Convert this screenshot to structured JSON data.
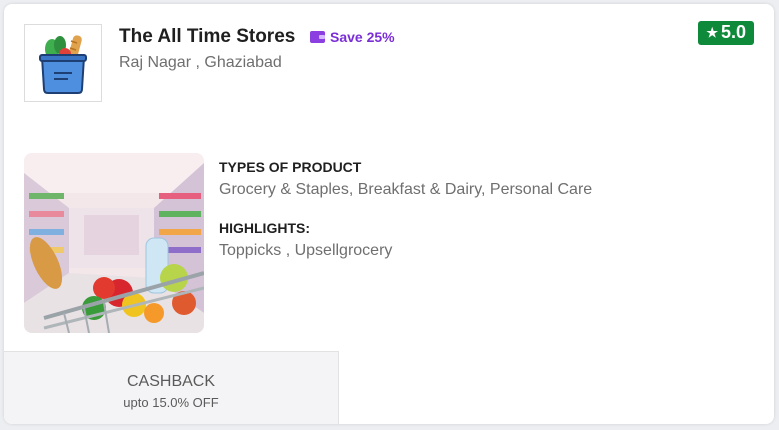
{
  "store": {
    "name": "The All Time Stores",
    "save_label": "Save 25%",
    "location": "Raj Nagar , Ghaziabad",
    "rating": "5.0",
    "logo_icon": "grocery-bag-icon",
    "photo": "supermarket-cart-photo"
  },
  "details": {
    "types_heading": "TYPES OF PRODUCT",
    "types_value": "Grocery & Staples, Breakfast & Dairy, Personal Care",
    "highlights_heading": "HIGHLIGHTS:",
    "highlights_value": "Toppicks , Upsellgrocery"
  },
  "cashback": {
    "title": "CASHBACK",
    "subtitle": "upto 15.0% OFF"
  },
  "colors": {
    "rating_bg": "#0f8a3a",
    "save_purple": "#7a2ed6"
  }
}
